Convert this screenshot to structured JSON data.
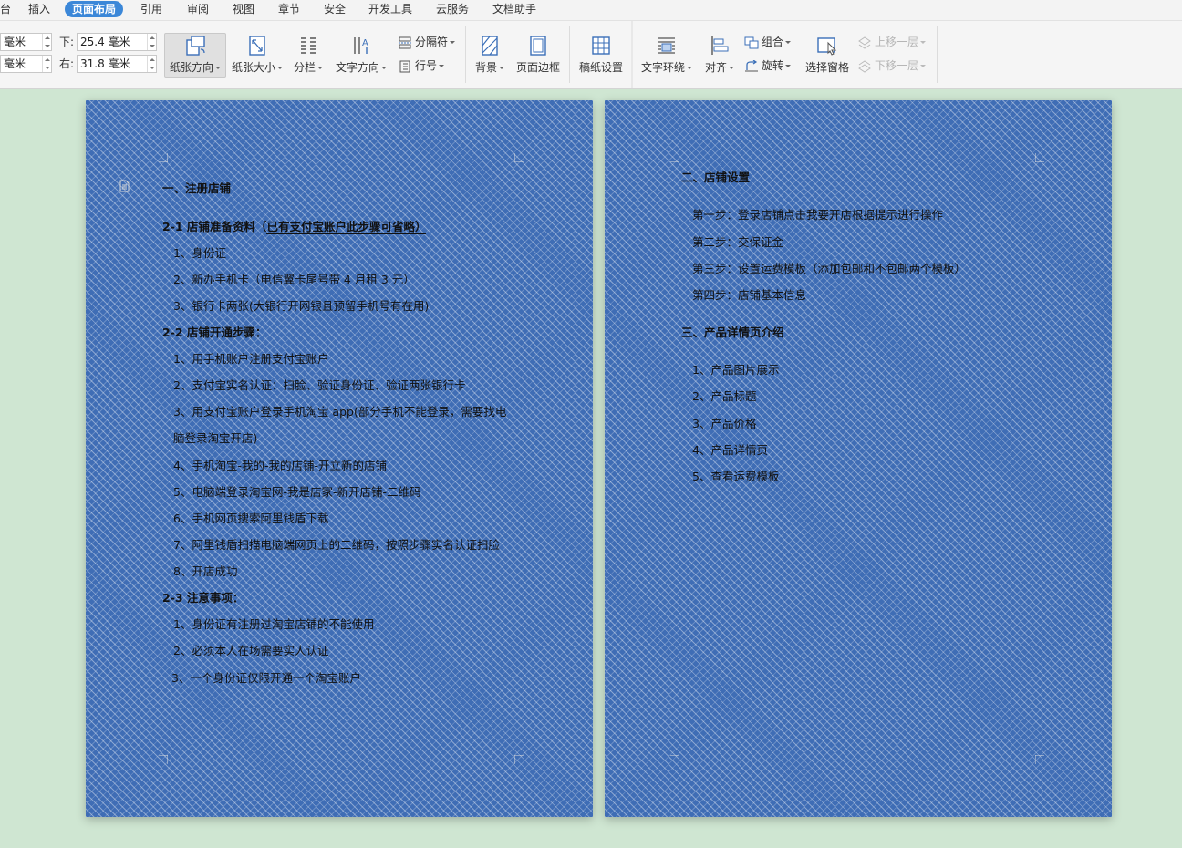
{
  "menu": {
    "tabs": [
      "台",
      "插入",
      "页面布局",
      "引用",
      "审阅",
      "视图",
      "章节",
      "安全",
      "开发工具",
      "云服务",
      "文档助手"
    ],
    "active_tab": "页面布局"
  },
  "margins": {
    "top_partial": "毫米",
    "bottom_partial": "毫米",
    "bottom_label": "下:",
    "bottom_value": "25.4 毫米",
    "right_label": "右:",
    "right_value": "31.8 毫米"
  },
  "ribbon": {
    "orientation": "纸张方向",
    "paper_size": "纸张大小",
    "columns": "分栏",
    "text_direction": "文字方向",
    "separator": "分隔符",
    "line_number": "行号",
    "background": "背景",
    "page_border": "页面边框",
    "manuscript": "稿纸设置",
    "text_wrap": "文字环绕",
    "align": "对齐",
    "group": "组合",
    "rotate": "旋转",
    "selection_pane": "选择窗格",
    "bring_forward": "上移一层",
    "send_backward": "下移一层"
  },
  "page1": {
    "lines": [
      "一、注册店铺",
      "2-1 店铺准备资料（",
      "已有支付宝账户此步骤可省略）",
      "1、身份证",
      "2、新办手机卡（电信翼卡尾号带 4 月租 3 元）",
      "3、银行卡两张(大银行开网银且预留手机号有在用)",
      "2-2 店铺开通步骤：",
      "1、用手机账户注册支付宝账户",
      "2、支付宝实名认证：扫脸、验证身份证、验证两张银行卡",
      "3、用支付宝账户登录手机淘宝 app(部分手机不能登录，需要找电",
      "脑登录淘宝开店)",
      "4、手机淘宝-我的-我的店铺-开立新的店铺",
      "5、电脑端登录淘宝网-我是店家-新开店铺-二维码",
      "6、手机网页搜索阿里钱盾下载",
      "7、阿里钱盾扫描电脑端网页上的二维码，按照步骤实名认证扫脸",
      "8、开店成功",
      "2-3 注意事项：",
      "1、身份证有注册过淘宝店铺的不能使用",
      "2、必须本人在场需要实人认证",
      "3、一个身份证仅限开通一个淘宝账户"
    ]
  },
  "page2": {
    "lines": [
      "二、店铺设置",
      "第一步：登录店铺点击我要开店根据提示进行操作",
      "第二步：交保证金",
      "第三步：设置运费模板（添加包邮和不包邮两个模板）",
      "第四步：店铺基本信息",
      "三、产品详情页介绍",
      "1、产品图片展示",
      "2、产品标题",
      "3、产品价格",
      "4、产品详情页",
      "5、查看运费模板"
    ]
  },
  "colors": {
    "page_background": "#3f6db5",
    "workspace": "#cfe6d2",
    "active_tab": "#3b87d8"
  }
}
